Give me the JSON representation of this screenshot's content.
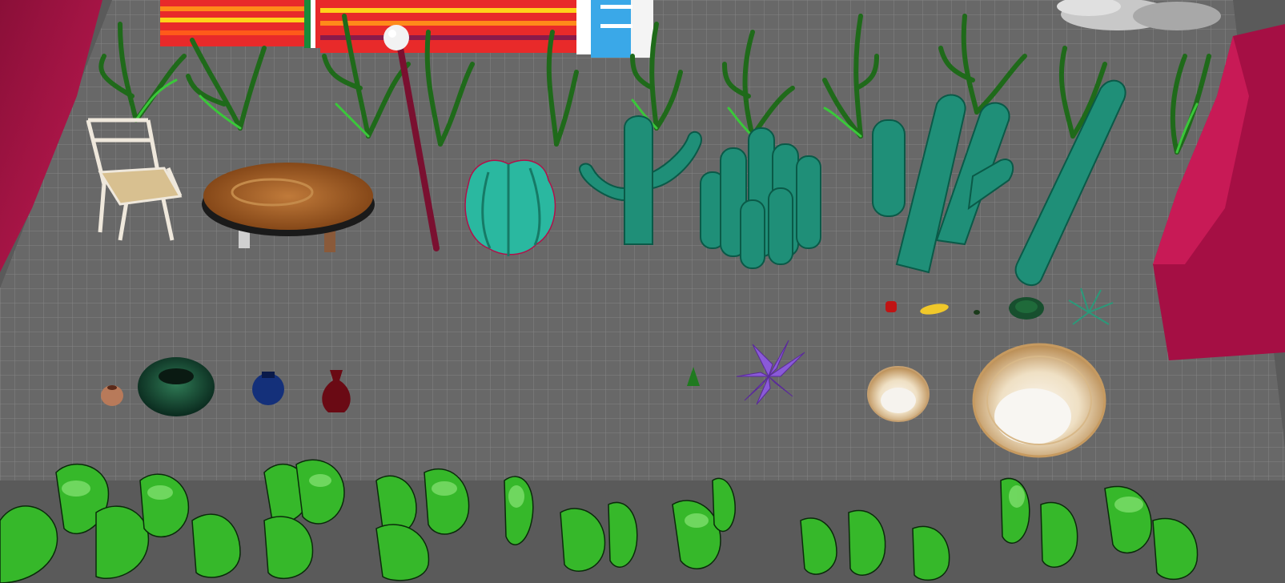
{
  "scene": {
    "kind": "3d-viewport-render",
    "ground": {
      "type": "grid-floor",
      "color": "#6a6a6a",
      "grid_color": "#8a8a8a"
    },
    "palette": {
      "background": "#5e5e5e",
      "magenta_wall": "#b0124a",
      "serape": [
        "#e8202a",
        "#ff7a10",
        "#ffd21a",
        "#1a8a3a",
        "#ffffff",
        "#3aa8e8",
        "#6a2a8a"
      ],
      "cactus": "#1f8f78",
      "agave": "#2ab8a0",
      "corn_leaf": "#1f7a1f",
      "foreground_leaves": "#4ad23a",
      "table_wood": "#a8602a",
      "basket": "#d8b880",
      "lavender_plant": "#8a5ad8"
    },
    "objects": [
      "serape-blanket",
      "magenta-wall-left",
      "magenta-wall-right",
      "rock-pile",
      "wooden-chair",
      "round-wooden-table",
      "lamp-post",
      "barrel-cactus",
      "saguaro-cactus",
      "organ-pipe-cactus-cluster",
      "large-cactus",
      "tall-column-cactus",
      "corn-plants",
      "clay-pot-small",
      "green-bowl",
      "blue-vase",
      "red-vase",
      "small-fir-sprout",
      "purple-plant",
      "small-woven-basket",
      "large-woven-basket",
      "red-pepper",
      "corn-cob",
      "small-seed",
      "dark-green-shrub",
      "teal-weed",
      "foreground-leafy-plants"
    ]
  }
}
